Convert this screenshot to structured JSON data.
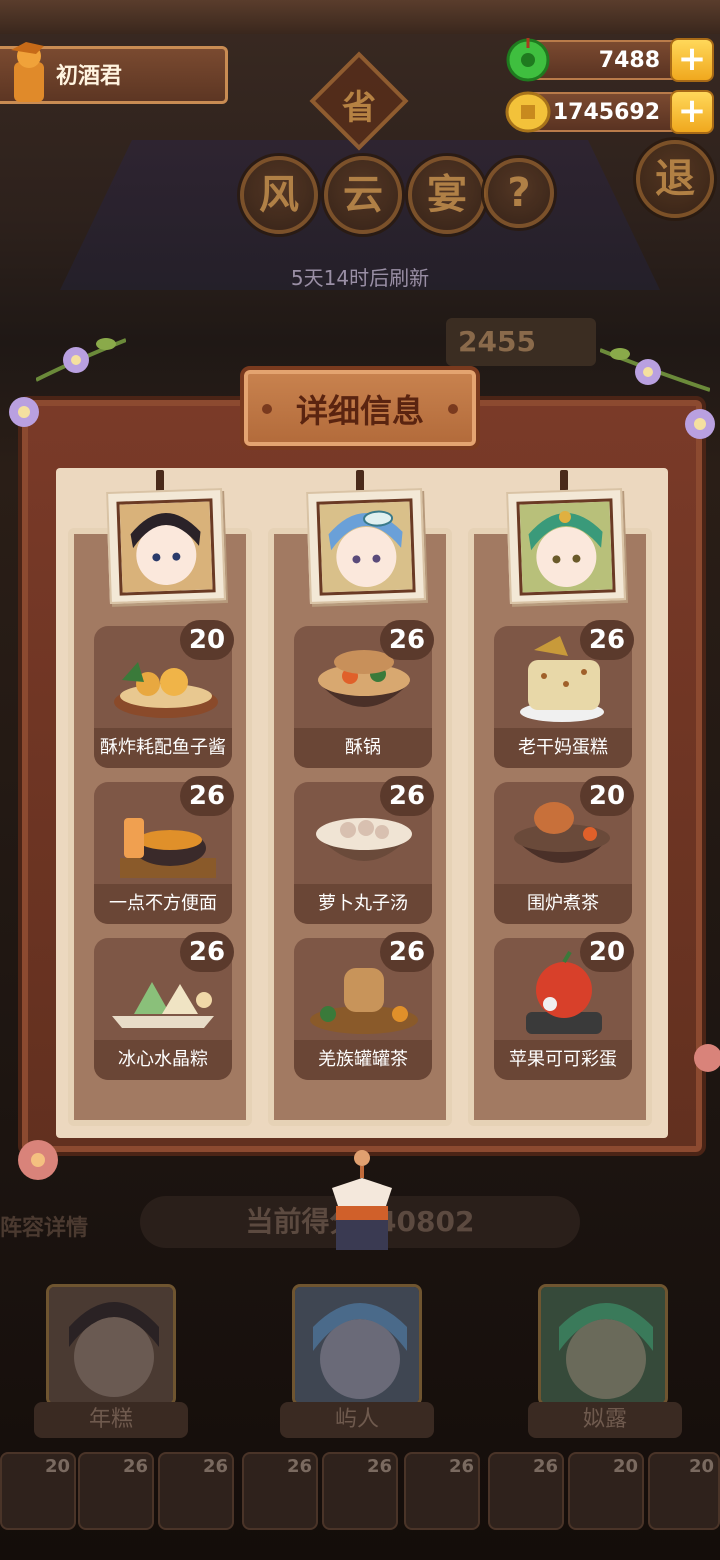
{
  "player": {
    "name": "初酒君"
  },
  "currencies": [
    {
      "icon": "jade-icon",
      "value": "7488"
    },
    {
      "icon": "coin-icon",
      "value": "1745692"
    }
  ],
  "header": {
    "badge": "省",
    "title_chars": [
      "风",
      "云",
      "宴"
    ],
    "help_label": "?",
    "exit_label": "退",
    "refresh_text": "5天14时后刷新",
    "score_partial": "2455"
  },
  "modal": {
    "title": "详细信息",
    "columns": [
      {
        "portrait": "character-portrait-1",
        "dishes": [
          {
            "name": "酥炸耗配鱼子酱",
            "level": "20"
          },
          {
            "name": "一点不方便面",
            "level": "26"
          },
          {
            "name": "冰心水晶粽",
            "level": "26"
          }
        ]
      },
      {
        "portrait": "character-portrait-2",
        "dishes": [
          {
            "name": "酥锅",
            "level": "26"
          },
          {
            "name": "萝卜丸子汤",
            "level": "26"
          },
          {
            "name": "羌族罐罐茶",
            "level": "26"
          }
        ]
      },
      {
        "portrait": "character-portrait-3",
        "dishes": [
          {
            "name": "老干妈蛋糕",
            "level": "26"
          },
          {
            "name": "围炉煮茶",
            "level": "20"
          },
          {
            "name": "苹果可可彩蛋",
            "level": "20"
          }
        ]
      }
    ]
  },
  "background": {
    "lineup_label": "阵容详情",
    "current_score": "当前得分140802",
    "characters": [
      "年糕",
      "屿人",
      "姒露"
    ],
    "mini_dishes": [
      "20",
      "26",
      "26",
      "26",
      "26",
      "26",
      "26",
      "20",
      "20"
    ]
  },
  "colors": {
    "frame": "#62301f",
    "panel": "#ecd8bf",
    "column": "#a27a62",
    "card": "#7e5746",
    "badge": "#5b3a2c",
    "gold": "#f0a81e"
  }
}
